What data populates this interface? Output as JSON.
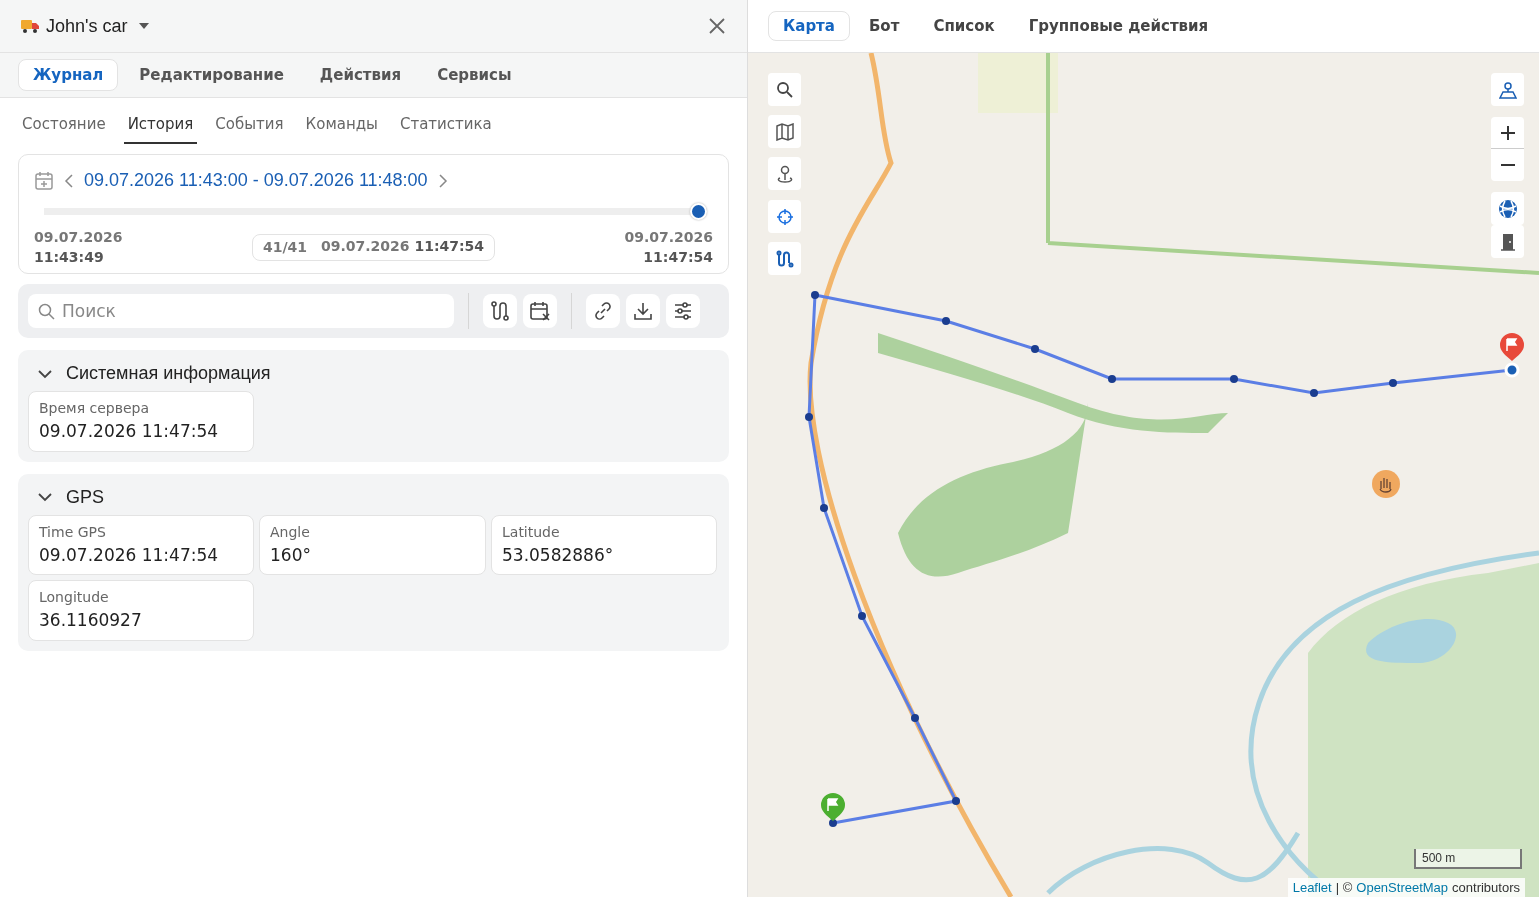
{
  "header": {
    "title": "John's car"
  },
  "main_tabs": [
    {
      "label": "Журнал",
      "selected": true
    },
    {
      "label": "Редактирование",
      "selected": false
    },
    {
      "label": "Действия",
      "selected": false
    },
    {
      "label": "Сервисы",
      "selected": false
    }
  ],
  "sub_tabs": [
    {
      "label": "Состояние",
      "selected": false
    },
    {
      "label": "История",
      "selected": true
    },
    {
      "label": "События",
      "selected": false
    },
    {
      "label": "Команды",
      "selected": false
    },
    {
      "label": "Статистика",
      "selected": false
    }
  ],
  "period": {
    "range": "09.07.2026 11:43:00 - 09.07.2026 11:48:00",
    "level": 1,
    "start_date": "09.07.2026",
    "start_time": "11:43:49",
    "counter": "41/41",
    "current_date": "09.07.2026",
    "current_time": "11:47:54",
    "end_date": "09.07.2026",
    "end_time": "11:47:54"
  },
  "search": {
    "placeholder": "Поиск"
  },
  "sections": [
    {
      "title": "Системная информация",
      "expanded": true,
      "fields": [
        {
          "label": "Время сервера",
          "value": "09.07.2026 11:47:54"
        }
      ]
    },
    {
      "title": "GPS",
      "expanded": true,
      "fields": [
        {
          "label": "Time GPS",
          "value": "09.07.2026 11:47:54"
        },
        {
          "label": "Angle",
          "value": "160°"
        },
        {
          "label": "Latitude",
          "value": "53.0582886°"
        },
        {
          "label": "Longitude",
          "value": "36.1160927"
        }
      ]
    }
  ],
  "map_tabs": [
    {
      "label": "Карта",
      "selected": true
    },
    {
      "label": "Бот",
      "selected": false
    },
    {
      "label": "Список",
      "selected": false
    },
    {
      "label": "Групповые действия",
      "selected": false
    }
  ],
  "map": {
    "scale": "500 m",
    "attribution_link": "Leaflet",
    "attribution_separator": "| ©",
    "attribution_source": "OpenStreetMap",
    "attribution_tail": "contributors"
  }
}
